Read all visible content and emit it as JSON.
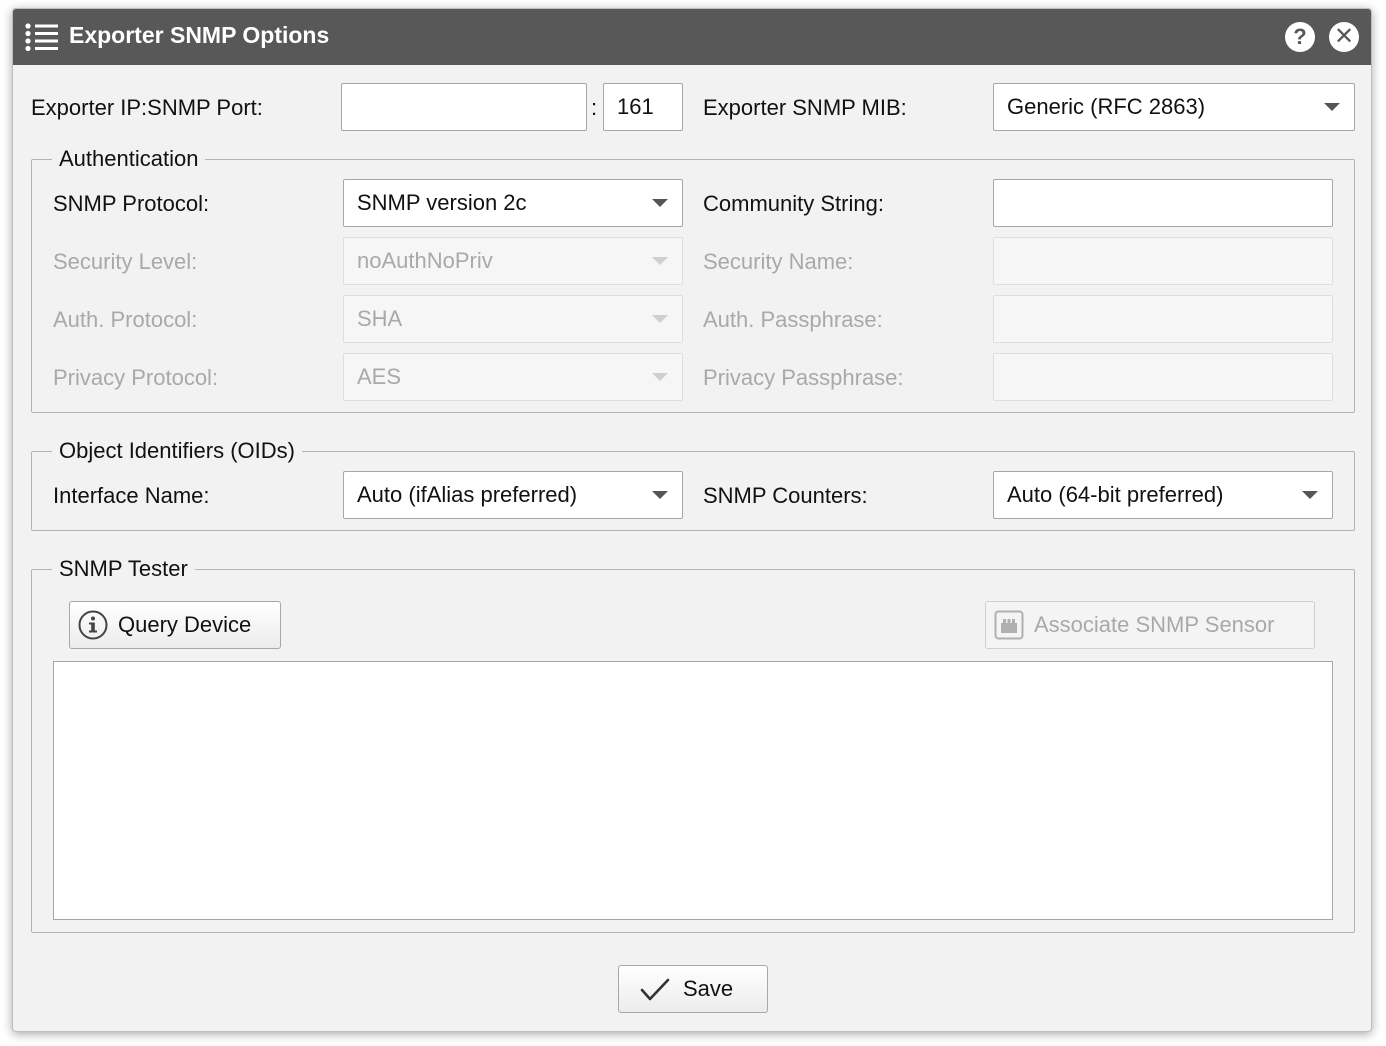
{
  "window": {
    "title": "Exporter SNMP Options",
    "icons": {
      "menu": "list-icon",
      "help": "help-icon",
      "close": "close-icon"
    },
    "help_glyph": "?",
    "close_glyph": "✕"
  },
  "top": {
    "ip_port_label": "Exporter IP:SNMP Port:",
    "ip_value": "",
    "separator": ":",
    "port_value": "161",
    "mib_label": "Exporter SNMP MIB:",
    "mib_value": "Generic (RFC 2863)"
  },
  "authentication": {
    "legend": "Authentication",
    "protocol_label": "SNMP Protocol:",
    "protocol_value": "SNMP version 2c",
    "community_label": "Community String:",
    "community_value": "",
    "security_level_label": "Security Level:",
    "security_level_value": "noAuthNoPriv",
    "security_name_label": "Security Name:",
    "security_name_value": "",
    "auth_protocol_label": "Auth. Protocol:",
    "auth_protocol_value": "SHA",
    "auth_pass_label": "Auth. Passphrase:",
    "auth_pass_value": "",
    "privacy_protocol_label": "Privacy Protocol:",
    "privacy_protocol_value": "AES",
    "privacy_pass_label": "Privacy Passphrase:",
    "privacy_pass_value": ""
  },
  "oids": {
    "legend": "Object Identifiers (OIDs)",
    "interface_label": "Interface Name:",
    "interface_value": "Auto (ifAlias preferred)",
    "counters_label": "SNMP Counters:",
    "counters_value": "Auto (64-bit preferred)"
  },
  "tester": {
    "legend": "SNMP Tester",
    "query_button": "Query Device",
    "query_icon": "info-icon",
    "associate_button": "Associate SNMP Sensor",
    "associate_icon": "sensor-icon",
    "output": ""
  },
  "footer": {
    "save_button": "Save",
    "save_icon": "checkmark-icon"
  },
  "colors": {
    "titlebar": "#585858",
    "panel": "#f2f2f2",
    "disabled_text": "#a9a9a9"
  }
}
